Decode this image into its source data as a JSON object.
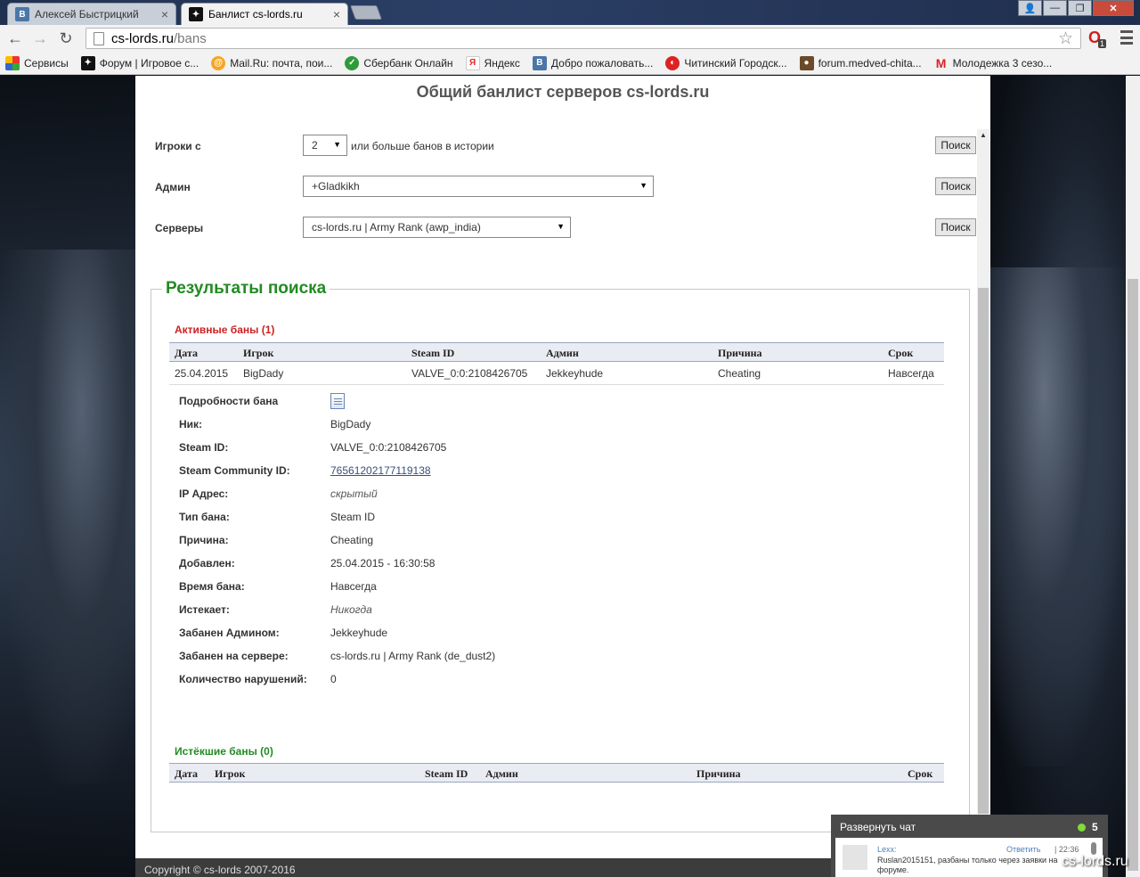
{
  "browser": {
    "tabs": [
      {
        "title": "Алексей Быстрицкий",
        "favicon": "vk-icon",
        "active": false
      },
      {
        "title": "Банлист cs-lords.ru",
        "favicon": "cs-icon",
        "active": true
      }
    ],
    "url_host": "cs-lords.ru",
    "url_path": "/bans",
    "extension_badge": "1",
    "bookmarks": [
      {
        "label": "Сервисы",
        "icon": "apps-icon"
      },
      {
        "label": "Форум | Игровое с...",
        "icon": "cs-icon"
      },
      {
        "label": "Mail.Ru: почта, пои...",
        "icon": "mailru-icon"
      },
      {
        "label": "Сбербанк Онлайн",
        "icon": "sberbank-icon"
      },
      {
        "label": "Яндекс",
        "icon": "yandex-icon"
      },
      {
        "label": "Добро пожаловать...",
        "icon": "vk-icon"
      },
      {
        "label": "Читинский Городск...",
        "icon": "chita-icon"
      },
      {
        "label": "forum.medved-chita...",
        "icon": "bear-icon"
      },
      {
        "label": "Молодежка 3 сезо...",
        "icon": "m-icon"
      }
    ]
  },
  "page": {
    "title": "Общий банлист серверов cs-lords.ru",
    "filters": {
      "players_label": "Игроки с",
      "players_value": "2",
      "players_suffix": "или больше банов в истории",
      "admin_label": "Админ",
      "admin_value": "+Gladkikh",
      "servers_label": "Серверы",
      "servers_value": "cs-lords.ru | Army Rank (awp_india)",
      "search_label": "Поиск"
    },
    "results": {
      "legend": "Результаты поиска",
      "active_title": "Активные баны (1)",
      "expired_title": "Истёкшие баны (0)",
      "columns": [
        "Дата",
        "Игрок",
        "Steam ID",
        "Админ",
        "Причина",
        "Срок"
      ],
      "active_rows": [
        {
          "date": "25.04.2015",
          "player": "BigDady",
          "steam_id": "VALVE_0:0:2108426705",
          "admin": "Jekkeyhude",
          "reason": "Cheating",
          "term": "Навсегда"
        }
      ],
      "details": {
        "header_label": "Подробности бана",
        "rows": [
          {
            "label": "Ник:",
            "value": "BigDady"
          },
          {
            "label": "Steam ID:",
            "value": "VALVE_0:0:2108426705"
          },
          {
            "label": "Steam Community ID:",
            "value": "76561202177119138"
          },
          {
            "label": "IP Адрес:",
            "value": "скрытый"
          },
          {
            "label": "Тип бана:",
            "value": "Steam ID"
          },
          {
            "label": "Причина:",
            "value": "Cheating"
          },
          {
            "label": "Добавлен:",
            "value": "25.04.2015 - 16:30:58"
          },
          {
            "label": "Время бана:",
            "value": "Навсегда"
          },
          {
            "label": "Истекает:",
            "value": "Никогда"
          },
          {
            "label": "Забанен Админом:",
            "value": "Jekkeyhude"
          },
          {
            "label": "Забанен на сервере:",
            "value": "cs-lords.ru | Army Rank (de_dust2)"
          },
          {
            "label": "Количество нарушений:",
            "value": "0"
          }
        ]
      }
    },
    "footer": "Copyright © cs-lords 2007-2016"
  },
  "chat": {
    "header": "Развернуть чат",
    "online_count": "5",
    "user": "Lexx:",
    "reply": "Ответить",
    "time": "| 22:36",
    "message": "Ruslan2015151, разбаны только через заявки на форуме."
  },
  "watermark": "cs-lords.ru",
  "colors": {
    "legend_green": "#228b22",
    "active_red": "#cc2222",
    "expired_green": "#228b22",
    "footer_bg": "#3c3c3c"
  }
}
